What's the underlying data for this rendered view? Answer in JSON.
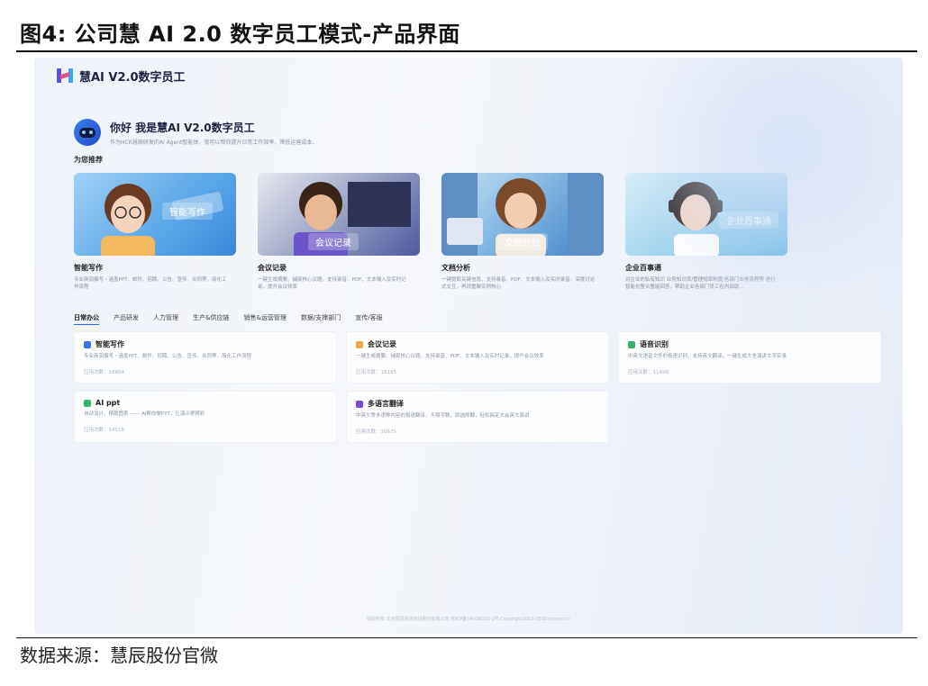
{
  "figure": {
    "title": "图4:  公司慧 AI 2.0 数字员工模式-产品界面",
    "source": "数据来源：慧辰股份官微"
  },
  "app": {
    "logo_text": "慧AI V2.0数字员工",
    "logo_icon": "brand-h-icon"
  },
  "greeting": {
    "title": "你好 我是慧AI V2.0数字员工",
    "subtitle": "作为HCR慧辰研发的AI Agent智能体，我可以帮你提升日常工作效率、降低运营成本。",
    "icon": "robot-icon"
  },
  "recommend": {
    "heading": "为您推荐",
    "cards": [
      {
        "name": "智能写作",
        "image_tag": "智能写作",
        "desc": "专业商润撰写・涵盖PPT、邮件、招聘、公告、宣传、合同等，简化工作流程",
        "bg": "#5aa7e8"
      },
      {
        "name": "会议记录",
        "image_tag": "会议记录",
        "desc": "一键生成摘要、捕捉核心议题。支持录音、PDF、文本输入及实时记录，提升会议效率",
        "bg": "#5a6fb4"
      },
      {
        "name": "文档分析",
        "image_tag": "文档分析",
        "desc": "一键提取关键信息、支持录音、PDF、文本输入及实时录音，深度讨论式交互，再现重聚实例核心",
        "bg": "#6aa2d8"
      },
      {
        "name": "企业百事通",
        "image_tag": "企业百事通",
        "desc": "对企业的私有知识 业务知识库/管理规章制度/各部门业务流程等 进行智能化整合整能回答，帮助企业各部门员工在内部助…",
        "bg": "#6ec1e4"
      }
    ]
  },
  "tabs": [
    {
      "label": "日常办公",
      "active": true
    },
    {
      "label": "产品研发",
      "active": false
    },
    {
      "label": "人力管理",
      "active": false
    },
    {
      "label": "生产&供应链",
      "active": false
    },
    {
      "label": "销售&运营管理",
      "active": false
    },
    {
      "label": "数据/支撑部门",
      "active": false
    },
    {
      "label": "宣传/客服",
      "active": false
    }
  ],
  "tools": [
    {
      "name": "智能写作",
      "desc": "专业商润撰写・涵盖PPT、邮件、招聘、公告、宣传、合同等，简化工作流程",
      "usage": "应用次数：16804",
      "icon_color": "#3b6ff0",
      "icon": "pen-icon"
    },
    {
      "name": "会议记录",
      "desc": "一键生成摘要、捕捉核心议题。支持录音、PDF、文本输入及实时记录，提升会议效率",
      "usage": "应用次数：16195",
      "icon_color": "#f0a640",
      "icon": "meeting-icon"
    },
    {
      "name": "语音识别",
      "desc": "中英文语音文件的极速识别，支持英文翻译，一键生成大全演讲文字实录",
      "usage": "应用次数：11499",
      "icon_color": "#34b36a",
      "icon": "voice-icon"
    },
    {
      "name": "AI ppt",
      "desc": "自动设计，精致图表 —— AI帮你做PPT，让演示更精彩",
      "usage": "应用次数：14516",
      "icon_color": "#34b36a",
      "icon": "ppt-icon"
    },
    {
      "name": "多语言翻译",
      "desc": "中英文等多语种内容的极速翻译，不限字数，即选即翻，轻松搞定大会英文演讲",
      "usage": "应用次数：10675",
      "icon_color": "#7a4ae0",
      "icon": "translate-icon"
    }
  ],
  "footer": "版权所有 北京慧辰资道资讯股份有限公司 京ICP备14026010-1号 Copyright2012-2028 hccorn.cn"
}
